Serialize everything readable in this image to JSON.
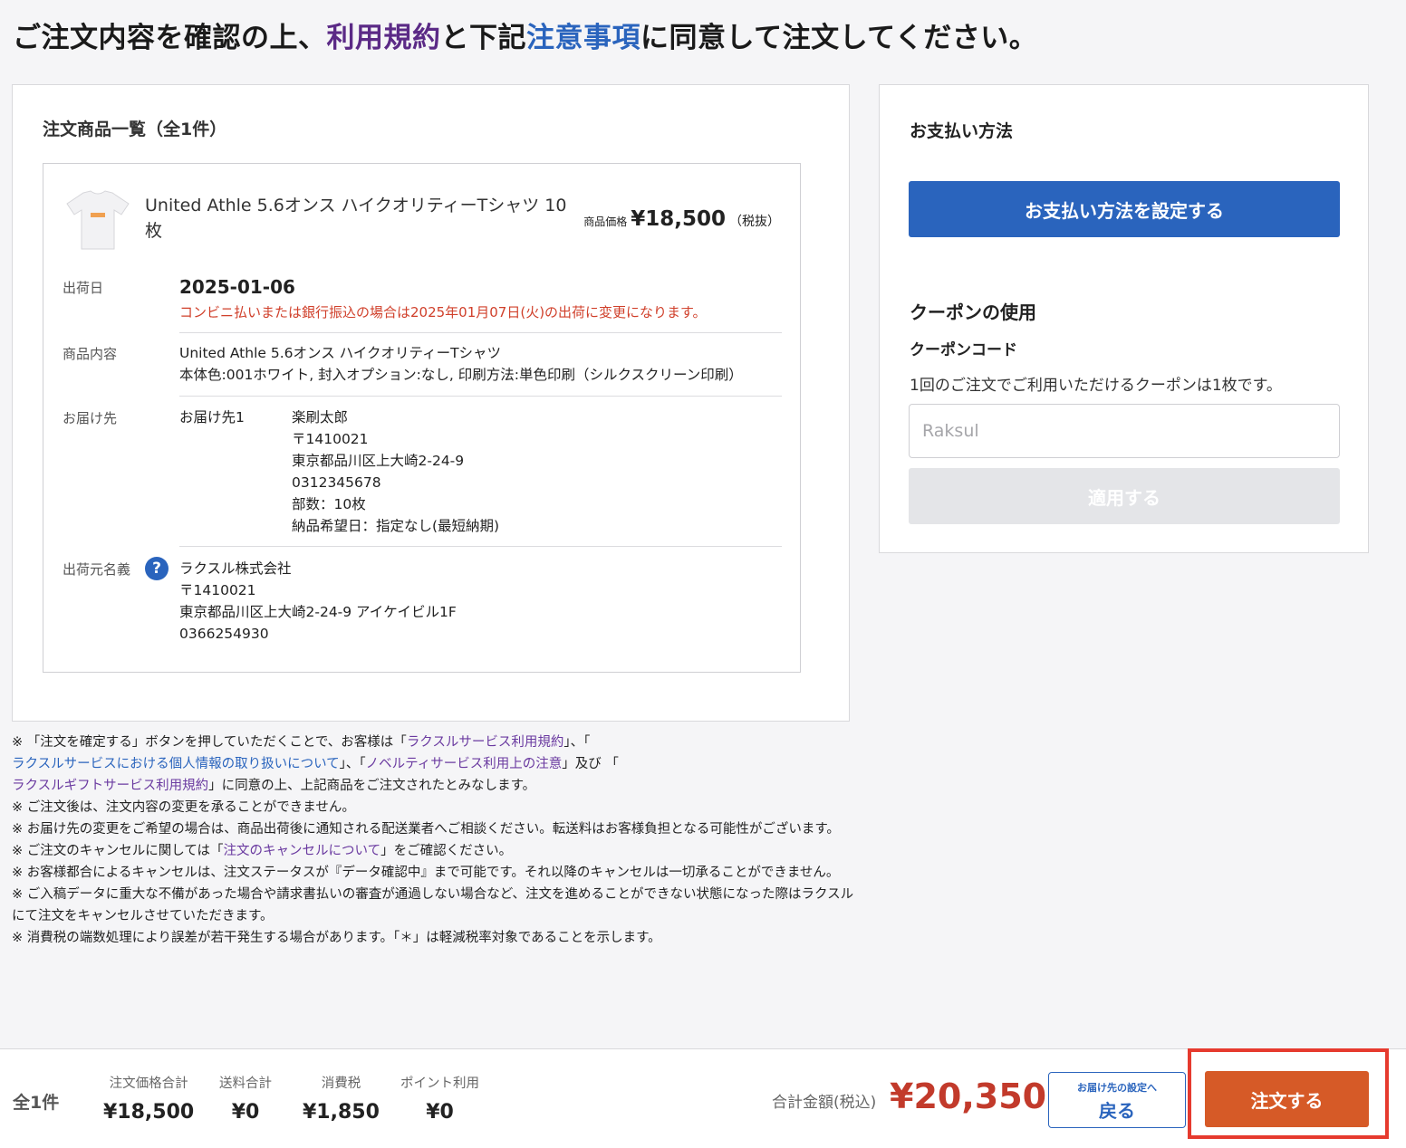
{
  "headline": {
    "part1": "ご注文内容を確認の上、",
    "terms_link": "利用規約",
    "part2": "と下記",
    "notes_link": "注意事項",
    "part3": "に同意して注文してください。"
  },
  "order_list": {
    "title": "注文商品一覧（全1件）",
    "item": {
      "name": "United Athle 5.6オンス ハイクオリティーTシャツ 10枚",
      "price_label": "商品価格",
      "price": "¥18,500",
      "tax_note": "（税抜）",
      "ship_date_label": "出荷日",
      "ship_date": "2025-01-06",
      "ship_note": "コンビニ払いまたは銀行振込の場合は2025年01月07日(火)の出荷に変更になります。",
      "content_label": "商品内容",
      "content_line1": "United Athle 5.6オンス ハイクオリティーTシャツ",
      "content_line2": "本体色:001ホワイト, 封入オプション:なし, 印刷方法:単色印刷（シルクスクリーン印刷）",
      "dest_label": "お届け先",
      "dest_name": "お届け先1",
      "dest_lines": [
        "楽刷太郎",
        "〒1410021",
        "東京都品川区上大崎2-24-9",
        "0312345678",
        "部数：10枚",
        "納品希望日：指定なし(最短納期)"
      ],
      "sender_label": "出荷元名義",
      "sender_lines": [
        "ラクスル株式会社",
        "〒1410021",
        "東京都品川区上大崎2-24-9 アイケイビル1F",
        "0366254930"
      ]
    }
  },
  "notes": {
    "n1_a": "※ 「注文を確定する」ボタンを押していただくことで、お客様は「",
    "n1_link1": "ラクスルサービス利用規約",
    "n1_b": "」、「",
    "n1_link2": "ラクスルサービスにおける個人情報の取り扱いについて",
    "n1_c": "」、「",
    "n1_link3": "ノベルティサービス利用上の注意",
    "n1_d": "」及び 「",
    "n1_link4": "ラクスルギフトサービス利用規約",
    "n1_e": "」に同意の上、上記商品をご注文されたとみなします。",
    "n2": "※ ご注文後は、注文内容の変更を承ることができません。",
    "n3": "※ お届け先の変更をご希望の場合は、商品出荷後に通知される配送業者へご相談ください。転送料はお客様負担となる可能性がございます。",
    "n4_a": "※ ご注文のキャンセルに関しては「",
    "n4_link": "注文のキャンセルについて",
    "n4_b": "」をご確認ください。",
    "n5": "※ お客様都合によるキャンセルは、注文ステータスが『データ確認中』まで可能です。それ以降のキャンセルは一切承ることができません。",
    "n6": "※ ご入稿データに重大な不備があった場合や請求書払いの審査が通過しない場合など、注文を進めることができない状態になった際はラクスルにて注文をキャンセルさせていただきます。",
    "n7": "※ 消費税の端数処理により誤差が若干発生する場合があります。「＊」は軽減税率対象であることを示します。"
  },
  "payment": {
    "title": "お支払い方法",
    "button": "お支払い方法を設定する",
    "coupon_title": "クーポンの使用",
    "coupon_code_label": "クーポンコード",
    "coupon_note": "1回のご注文でご利用いただけるクーポンは1枚です。",
    "coupon_placeholder": "Raksul",
    "apply_button": "適用する"
  },
  "footer": {
    "count": "全1件",
    "subtotal_label": "注文価格合計",
    "subtotal": "¥18,500",
    "shipping_label": "送料合計",
    "shipping": "¥0",
    "tax_label": "消費税",
    "tax": "¥1,850",
    "points_label": "ポイント利用",
    "points": "¥0",
    "total_label": "合計金額(税込)",
    "total": "¥20,350",
    "back_small": "お届け先の設定へ",
    "back_main": "戻る",
    "order_button": "注文する"
  },
  "colors": {
    "accent_blue": "#2a64bd",
    "order_orange": "#d65a27",
    "total_red": "#c23a2b",
    "highlight_red": "#e63a2e"
  }
}
